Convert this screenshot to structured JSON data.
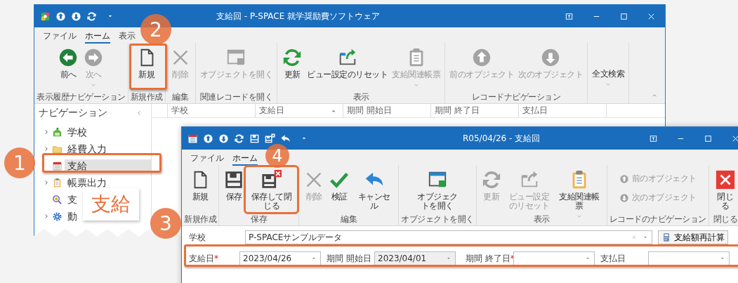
{
  "main_window": {
    "title": "支給回 - P-SPACE 就学奨励費ソフトウェア",
    "tabs": [
      {
        "label": "ファイル",
        "selected": false
      },
      {
        "label": "ホーム",
        "selected": true
      },
      {
        "label": "表示",
        "selected": false
      }
    ],
    "ribbon": [
      {
        "label": "表示履歴ナビゲーション",
        "kind": "large",
        "buttons": [
          {
            "label": "前へ",
            "disabled": false
          },
          {
            "label": "次へ",
            "disabled": true,
            "dropdown": true
          }
        ]
      },
      {
        "label": "新規作成",
        "kind": "large",
        "buttons": [
          {
            "label": "新規",
            "disabled": false
          }
        ]
      },
      {
        "label": "編集",
        "kind": "large",
        "buttons": [
          {
            "label": "削除",
            "disabled": true
          }
        ]
      },
      {
        "label": "関連レコードを開く",
        "kind": "large",
        "buttons": [
          {
            "label": "オブジェクトを開く",
            "disabled": true
          }
        ]
      },
      {
        "label": "表示",
        "kind": "large",
        "buttons": [
          {
            "label": "更新",
            "disabled": false
          },
          {
            "label": "ビュー設定のリセット",
            "disabled": false
          },
          {
            "label": "支給関連帳票",
            "disabled": true,
            "dropdown": true
          }
        ]
      },
      {
        "label": "レコードナビゲーション",
        "kind": "large",
        "buttons": [
          {
            "label": "前のオブジェクト",
            "disabled": true
          },
          {
            "label": "次のオブジェクト",
            "disabled": true
          }
        ]
      },
      {
        "kind": "large",
        "buttons": [
          {
            "label": "全文検索",
            "disabled": false,
            "dropdown": true
          }
        ]
      }
    ],
    "navigation": {
      "title": "ナビゲーション",
      "items": [
        {
          "label": "学校",
          "expandable": true,
          "selected": false
        },
        {
          "label": "経費入力",
          "expandable": true,
          "selected": false
        },
        {
          "label": "支給",
          "expandable": false,
          "selected": true
        },
        {
          "label": "帳票出力",
          "expandable": true,
          "selected": false
        },
        {
          "label": "支",
          "expandable": false,
          "selected": false
        },
        {
          "label": "動",
          "expandable": true,
          "selected": false
        }
      ]
    },
    "columns": [
      {
        "label": "学校",
        "sorted": false
      },
      {
        "label": "支給日",
        "sorted": true
      },
      {
        "label": "期間 開始日",
        "sorted": false
      },
      {
        "label": "期間 終了日",
        "sorted": false
      },
      {
        "label": "支払日",
        "sorted": false
      }
    ]
  },
  "record_window": {
    "title": "R05/04/26 - 支給回",
    "tabs": [
      {
        "label": "ファイル",
        "selected": false
      },
      {
        "label": "ホーム",
        "selected": true
      }
    ],
    "ribbon": [
      {
        "label": "新規作成",
        "kind": "large",
        "buttons": [
          {
            "label": "新規",
            "disabled": false
          }
        ]
      },
      {
        "label": "保存",
        "kind": "large",
        "buttons": [
          {
            "label": "保存",
            "disabled": false
          },
          {
            "label": "保存して閉じる",
            "disabled": false
          }
        ]
      },
      {
        "label": "編集",
        "kind": "large",
        "buttons": [
          {
            "label": "削除",
            "disabled": true
          },
          {
            "label": "検証",
            "disabled": false
          },
          {
            "label": "キャンセル",
            "disabled": false
          }
        ]
      },
      {
        "label": "オブジェクトを開く",
        "kind": "large",
        "buttons": [
          {
            "label": "オブジェクトを開く",
            "disabled": false
          }
        ]
      },
      {
        "label": "表示",
        "kind": "large",
        "buttons": [
          {
            "label": "更新",
            "disabled": true
          },
          {
            "label": "ビュー設定のリセット",
            "disabled": true
          },
          {
            "label": "支給関連帳票",
            "disabled": false,
            "dropdown": true
          }
        ]
      },
      {
        "label": "レコードのナビゲーション",
        "kind": "stacked",
        "buttons": [
          {
            "label": "前のオブジェクト",
            "disabled": true
          },
          {
            "label": "次のオブジェクト",
            "disabled": true
          }
        ]
      },
      {
        "label": "閉じる",
        "kind": "large",
        "buttons": [
          {
            "label": "閉じる",
            "disabled": false
          }
        ]
      }
    ],
    "form": {
      "school": {
        "label": "学校",
        "value": "P-SPACEサンプルデータ"
      },
      "recalc_button": "支給額再計算",
      "fields": [
        {
          "label": "支給日",
          "marker": "*",
          "value": "2023/04/26",
          "disabled": false
        },
        {
          "label": "期間 開始日",
          "value": "2023/04/01",
          "disabled": true
        },
        {
          "label": "期間 終了日",
          "marker": "*",
          "disabled": false
        },
        {
          "label": "支払日",
          "disabled": false
        }
      ]
    }
  },
  "annotations": {
    "steps": [
      {
        "number": "1"
      },
      {
        "number": "2"
      },
      {
        "number": "3"
      },
      {
        "number": "4"
      }
    ],
    "caption": "支給"
  }
}
